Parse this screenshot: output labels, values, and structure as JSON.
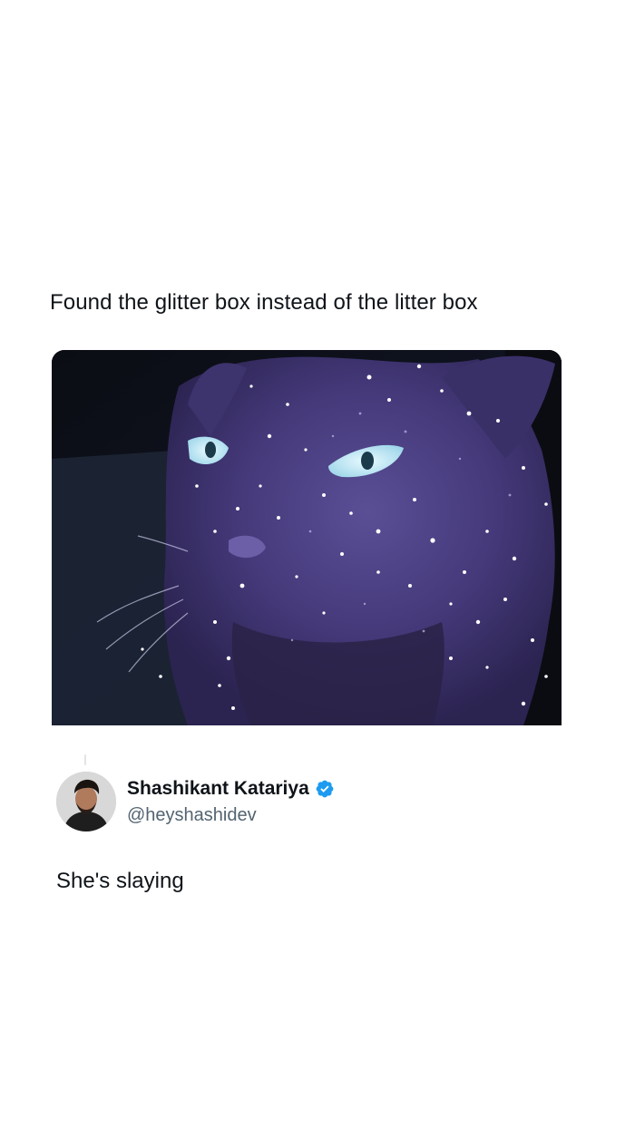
{
  "tweet": {
    "text": "Found the glitter box instead of the litter box"
  },
  "reply": {
    "author_name": "Shashikant Katariya",
    "author_handle": "@heyshashidev",
    "verified_icon": "verified-badge-icon",
    "text": "She's slaying"
  },
  "colors": {
    "text_primary": "#0f1419",
    "text_secondary": "#536471",
    "verified_blue": "#1d9bf0",
    "cat_purple": "#4a3f7e"
  }
}
